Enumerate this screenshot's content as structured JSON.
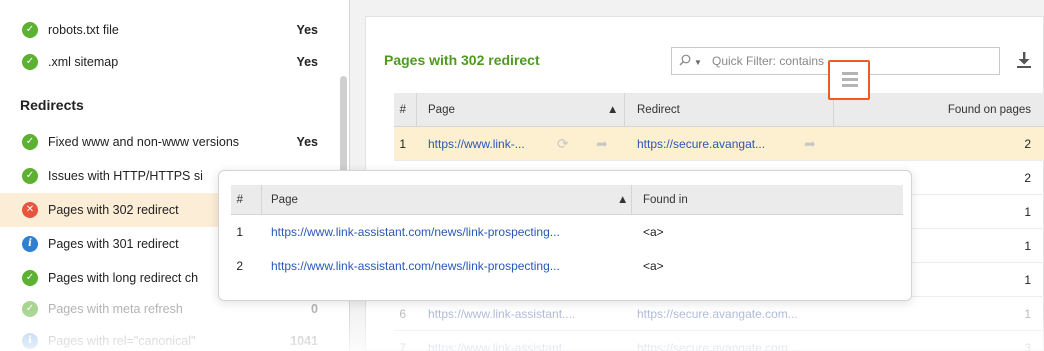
{
  "sidebar": {
    "top_items": [
      {
        "label": "robots.txt file",
        "value": "Yes",
        "status": "ok"
      },
      {
        "label": ".xml sitemap",
        "value": "Yes",
        "status": "ok"
      }
    ],
    "section_heading": "Redirects",
    "items": [
      {
        "label": "Fixed www and non-www versions",
        "value": "Yes",
        "status": "ok"
      },
      {
        "label": "Issues with HTTP/HTTPS si",
        "value": "",
        "status": "ok"
      },
      {
        "label": "Pages with 302 redirect",
        "value": "",
        "status": "error"
      },
      {
        "label": "Pages with 301 redirect",
        "value": "",
        "status": "info"
      },
      {
        "label": "Pages with long redirect ch",
        "value": "",
        "status": "ok"
      },
      {
        "label": "Pages with meta refresh",
        "value": "0",
        "status": "ok"
      },
      {
        "label": "Pages with rel=\"canonical\"",
        "value": "1041",
        "status": "info"
      }
    ]
  },
  "panel": {
    "title": "Pages with 302 redirect",
    "filter_placeholder": "Quick Filter: contains",
    "columns": {
      "num": "#",
      "page": "Page",
      "redirect": "Redirect",
      "found": "Found on pages"
    },
    "rows": [
      {
        "num": "1",
        "page": "https://www.link-...",
        "redirect": "https://secure.avangat...",
        "found": "2"
      },
      {
        "num": "",
        "page": "",
        "redirect": "",
        "found": "2"
      },
      {
        "num": "",
        "page": "",
        "redirect": "",
        "found": "1"
      },
      {
        "num": "",
        "page": "",
        "redirect": "",
        "found": "1"
      },
      {
        "num": "",
        "page": "",
        "redirect": "",
        "found": "1"
      },
      {
        "num": "6",
        "page": "https://www.link-assistant....",
        "redirect": "https://secure.avangate.com...",
        "found": "1"
      },
      {
        "num": "7",
        "page": "https://www.link-assistant...",
        "redirect": "https://secure.avangate.com...",
        "found": "3"
      }
    ]
  },
  "popup": {
    "columns": {
      "num": "#",
      "page": "Page",
      "found_in": "Found in"
    },
    "rows": [
      {
        "num": "1",
        "page": "https://www.link-assistant.com/news/link-prospecting...",
        "found_in": "<a>"
      },
      {
        "num": "2",
        "page": "https://www.link-assistant.com/news/link-prospecting...",
        "found_in": "<a>"
      }
    ]
  },
  "colors": {
    "accent_green": "#4d9a1f",
    "highlight_orange": "#f15a24",
    "selected_row": "#fbedd6",
    "link_blue": "#2a57b8"
  }
}
